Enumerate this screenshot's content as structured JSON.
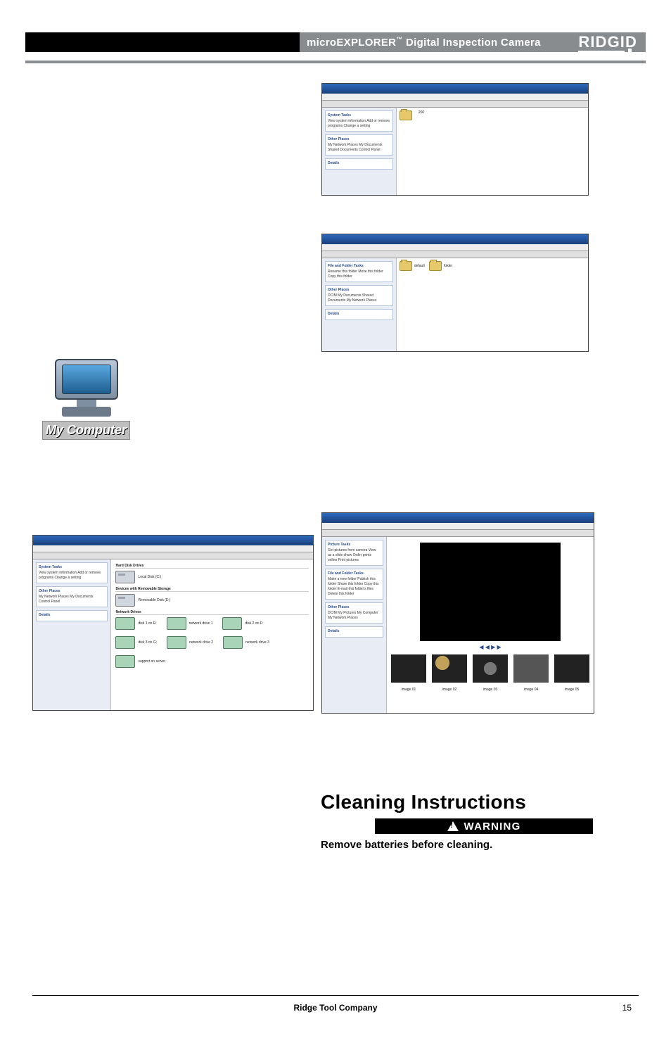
{
  "header": {
    "title_prefix": "microEXPLORER",
    "tm": "™",
    "title_suffix": " Digital Inspection Camera",
    "brand": "RIDGID"
  },
  "mycomputer_caption": "My Computer",
  "screenshots": {
    "s1": {
      "sidebar": {
        "h1": "System Tasks",
        "l1": "View system information\nAdd or remove programs\nChange a setting",
        "h2": "Other Places",
        "l2": "My Network Places\nMy Documents\nShared Documents\nControl Panel",
        "h3": "Details"
      },
      "folder_labels": {
        "a": "200"
      }
    },
    "s2": {
      "sidebar": {
        "h1": "File and Folder Tasks",
        "l1": "Rename this folder\nMove this folder\nCopy this folder",
        "h2": "Other Places",
        "l2": "DCIM\nMy Documents\nShared Documents\nMy Network Places",
        "h3": "Details"
      },
      "folder_labels": {
        "a": "default",
        "b": "folder"
      }
    },
    "s3": {
      "sidebar": {
        "h1": "System Tasks",
        "l1": "View system information\nAdd or remove programs\nChange a setting",
        "h2": "Other Places",
        "l2": "My Network Places\nMy Documents\nControl Panel",
        "h3": "Details"
      },
      "sections": {
        "hdd": "Hard Disk Drives",
        "hdd_a": "Local Disk (C:)",
        "rem": "Devices with Removable Storage",
        "rem_a": "Removable Disk (E:)",
        "net": "Network Drives",
        "na": "disk 1 on E:",
        "nb": "network drive 1",
        "nc": "disk 2 on F:",
        "nd": "disk 3 on G:",
        "ne": "network drive 2",
        "nf": "network drive 3",
        "ng": "support on server"
      }
    },
    "s4": {
      "sidebar": {
        "h1": "Picture Tasks",
        "l1": "Get pictures from camera\nView as a slide show\nOrder prints online\nPrint pictures",
        "h2": "File and Folder Tasks",
        "l2": "Make a new folder\nPublish this folder\nShare this folder\nCopy this folder\nE-mail this folder's files\nDelete this folder",
        "h3": "Other Places",
        "l3": "DCIM\nMy Pictures\nMy Computer\nMy Network Places",
        "h4": "Details"
      },
      "controls": "◀ ◀ ▶ ▶",
      "thumbs": {
        "a": "image 01",
        "b": "image 02",
        "c": "image 03",
        "d": "image 04",
        "e": "image 05"
      }
    }
  },
  "cleaning": {
    "heading": "Cleaning Instructions",
    "warning_label": "WARNING",
    "warning_text": "Remove batteries before cleaning."
  },
  "footer": {
    "company": "Ridge Tool Company",
    "page": "15"
  }
}
